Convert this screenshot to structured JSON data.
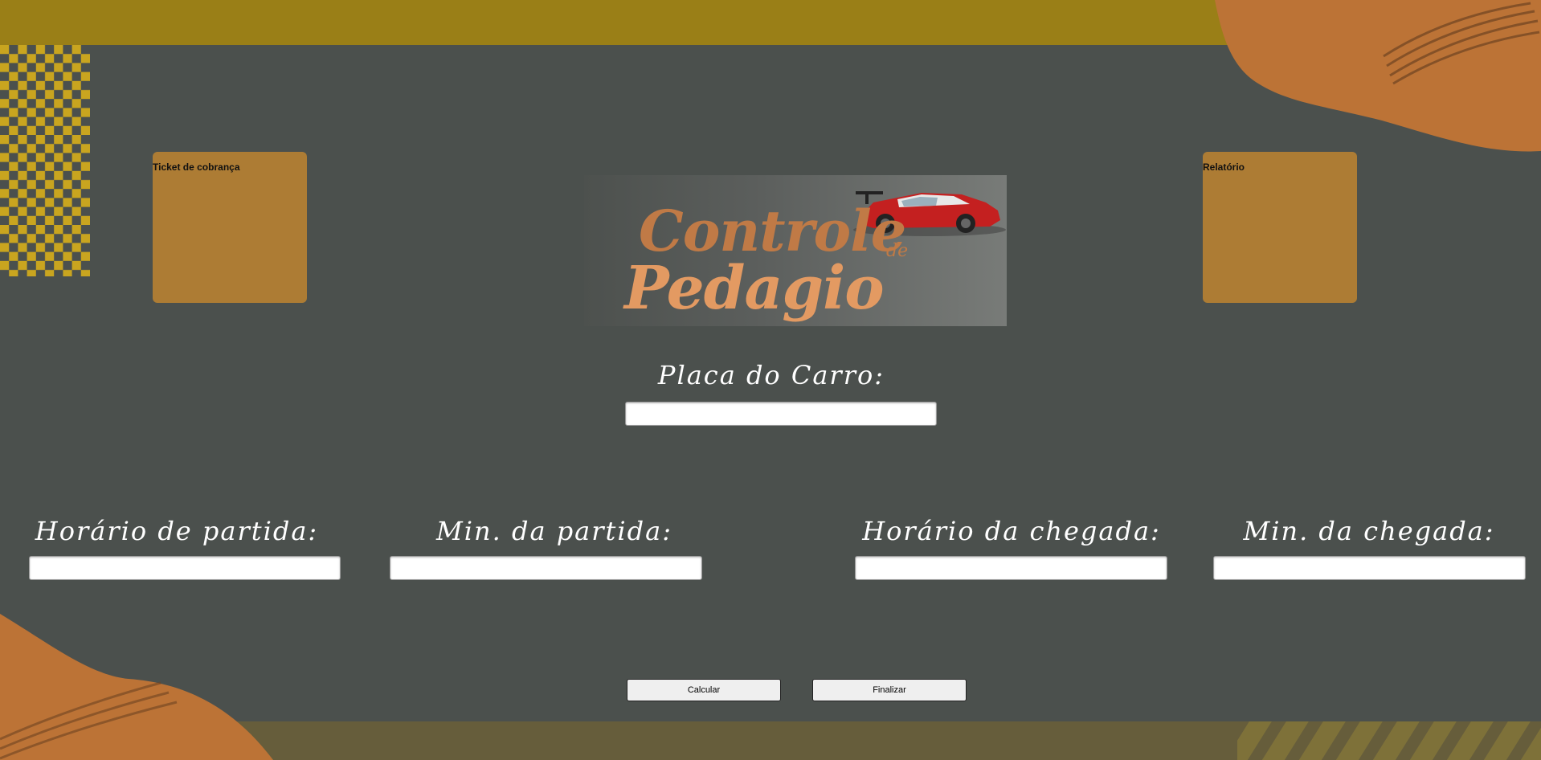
{
  "page": {
    "background_color": "#4b504d",
    "accent_color": "#ad7c34"
  },
  "side_boxes": {
    "ticket_label": "Ticket de cobrança",
    "relatorio_label": "Relatório"
  },
  "logo": {
    "line1": "Controle",
    "connector": "de",
    "line2": "Pedagio",
    "image": "red-sports-car-icon"
  },
  "form": {
    "placa_label": "Placa do Carro:",
    "placa_value": "",
    "fields": [
      {
        "label": "Horário de partida:",
        "value": ""
      },
      {
        "label": "Min. da partida:",
        "value": ""
      },
      {
        "label": "Horário da chegada:",
        "value": ""
      },
      {
        "label": "Min. da chegada:",
        "value": ""
      }
    ]
  },
  "buttons": {
    "calcular": "Calcular",
    "finalizar": "Finalizar"
  }
}
